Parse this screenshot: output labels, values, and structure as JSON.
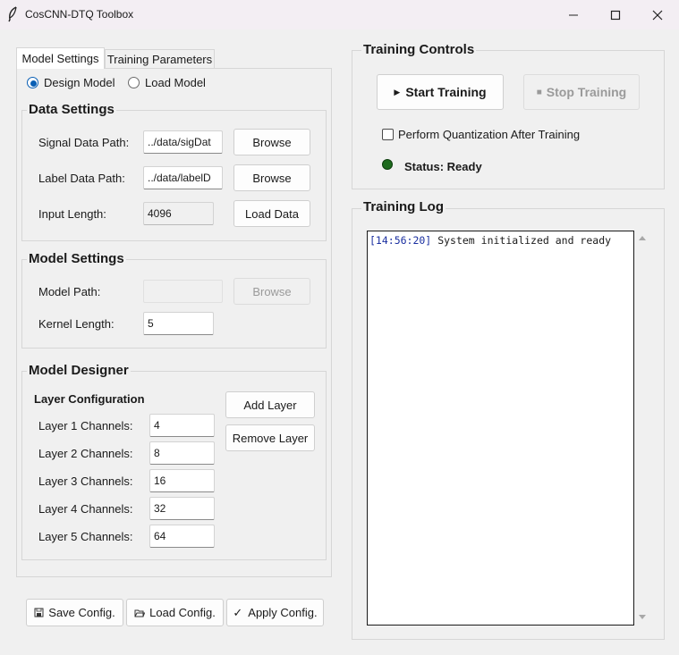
{
  "window": {
    "title": "CosCNN-DTQ Toolbox",
    "icon": "feather-icon",
    "controls": [
      "minimize-icon",
      "maximize-icon",
      "close-icon"
    ]
  },
  "tabs": [
    {
      "label": "Model Settings",
      "active": true
    },
    {
      "label": "Training Parameters",
      "active": false
    }
  ],
  "mode": {
    "options": [
      "Design Model",
      "Load Model"
    ],
    "selected": "Design Model"
  },
  "data_settings": {
    "title": "Data Settings",
    "signal_label": "Signal Data Path:",
    "signal_value": "../data/sigDat",
    "label_label": "Label Data Path:",
    "label_value": "../data/labelD",
    "input_length_label": "Input Length:",
    "input_length_value": "4096",
    "browse": "Browse",
    "load_data": "Load Data"
  },
  "model_settings": {
    "title": "Model Settings",
    "model_path_label": "Model Path:",
    "model_path_value": "",
    "browse": "Browse",
    "kernel_label": "Kernel Length:",
    "kernel_value": "5"
  },
  "model_designer": {
    "title": "Model Designer",
    "layer_config_title": "Layer Configuration",
    "add_layer": "Add Layer",
    "remove_layer": "Remove Layer",
    "layers": [
      {
        "label": "Layer 1 Channels:",
        "value": "4"
      },
      {
        "label": "Layer 2 Channels:",
        "value": "8"
      },
      {
        "label": "Layer 3 Channels:",
        "value": "16"
      },
      {
        "label": "Layer 4 Channels:",
        "value": "32"
      },
      {
        "label": "Layer 5 Channels:",
        "value": "64"
      }
    ]
  },
  "config_buttons": {
    "save": "Save Config.",
    "load": "Load Config.",
    "apply": "Apply Config."
  },
  "training_controls": {
    "title": "Training Controls",
    "start": "Start Training",
    "stop": "Stop Training",
    "quantize_label": "Perform Quantization After Training",
    "quantize_checked": false,
    "status": "Status: Ready",
    "status_color": "#1e6b1e"
  },
  "training_log": {
    "title": "Training Log",
    "entries": [
      {
        "time": "[14:56:20]",
        "message": "System initialized and ready"
      }
    ]
  }
}
